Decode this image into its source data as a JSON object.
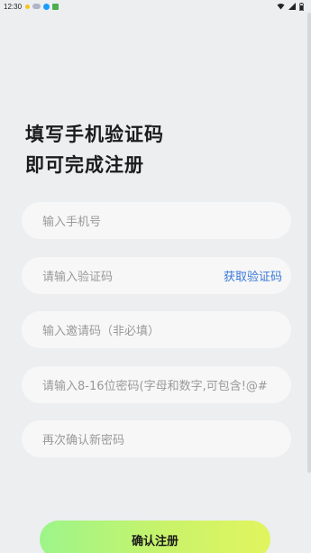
{
  "status_bar": {
    "time": "12:30",
    "colors": {
      "sun": "#f5c518",
      "cloud": "#b0b4c8",
      "app1": "#1a9cff",
      "app2": "#4caf50"
    }
  },
  "headline": {
    "line1": "填写手机验证码",
    "line2": "即可完成注册"
  },
  "form": {
    "phone_placeholder": "输入手机号",
    "code_placeholder": "请输入验证码",
    "get_code_label": "获取验证码",
    "invite_placeholder": "输入邀请码（非必填）",
    "password_placeholder": "请输入8-16位密码(字母和数字,可包含!@#",
    "confirm_password_placeholder": "再次确认新密码"
  },
  "submit_label": "确认注册",
  "colors": {
    "background": "#eceef0",
    "field_bg": "#f7f7f7",
    "link": "#3a78d8",
    "button_gradient_start": "#9cf58a",
    "button_gradient_end": "#e1f45e"
  }
}
